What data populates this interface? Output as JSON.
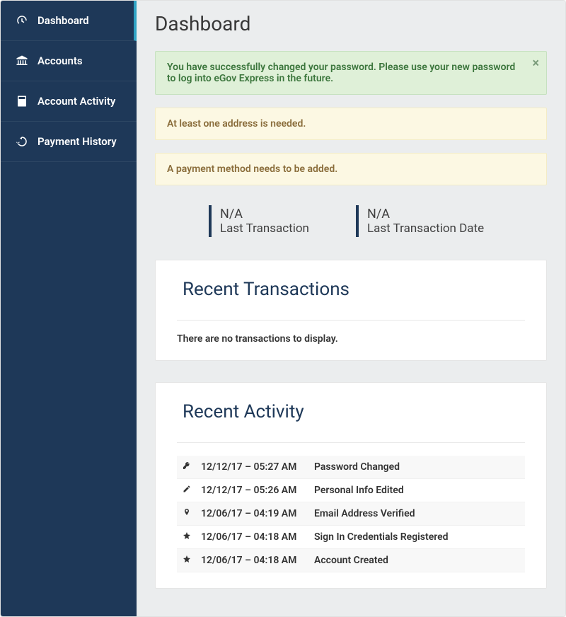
{
  "sidebar": {
    "items": [
      {
        "label": "Dashboard",
        "icon": "gauge",
        "active": true
      },
      {
        "label": "Accounts",
        "icon": "bank",
        "active": false
      },
      {
        "label": "Account Activity",
        "icon": "calculator",
        "active": false
      },
      {
        "label": "Payment History",
        "icon": "history",
        "active": false
      }
    ]
  },
  "page_title": "Dashboard",
  "alerts": {
    "success": "You have successfully changed your password. Please use your new password to log into eGov Express in the future.",
    "warnings": [
      "At least one address is needed.",
      "A payment method needs to be added."
    ]
  },
  "stats": [
    {
      "value": "N/A",
      "label": "Last Transaction"
    },
    {
      "value": "N/A",
      "label": "Last Transaction Date"
    }
  ],
  "recent_transactions": {
    "heading": "Recent Transactions",
    "empty_message": "There are no transactions to display."
  },
  "recent_activity": {
    "heading": "Recent Activity",
    "rows": [
      {
        "icon": "key",
        "time": "12/12/17 – 05:27 AM",
        "event": "Password Changed"
      },
      {
        "icon": "pencil",
        "time": "12/12/17 – 05:26 AM",
        "event": "Personal Info Edited"
      },
      {
        "icon": "pin",
        "time": "12/06/17 – 04:19 AM",
        "event": "Email Address Verified"
      },
      {
        "icon": "star",
        "time": "12/06/17 – 04:18 AM",
        "event": "Sign In Credentials Registered"
      },
      {
        "icon": "star",
        "time": "12/06/17 – 04:18 AM",
        "event": "Account Created"
      }
    ]
  }
}
